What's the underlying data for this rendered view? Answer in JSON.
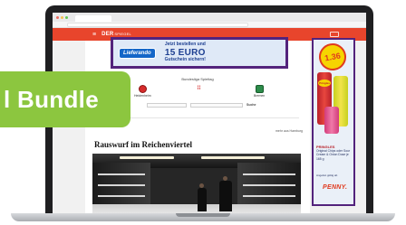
{
  "badge": {
    "label": "l Bundle"
  },
  "browser": {
    "tab_title": ""
  },
  "site": {
    "logo": "DER",
    "logo_sub": "SPIEGEL"
  },
  "ad_top": {
    "brand": "Lieferando",
    "line1": "Jetzt bestellen und",
    "amount": "15 EURO",
    "line2": "Gutschein sichern!"
  },
  "ad_side": {
    "price": "1.36",
    "product_label": "Pringles",
    "headline": "PRINGLES",
    "description": "Original Chips oder Sour Cream & Onion Dose je 165 g",
    "cta": "Angebot gültig ab",
    "brand": "PENNY."
  },
  "match": {
    "title": "Bundesliga Spieltag",
    "team_left": "Heidenheim",
    "team_mid": "",
    "team_right": "Bremen",
    "select_1": "",
    "select_2": "",
    "go": "Suche"
  },
  "section_meta": "mehr aus Hamburg",
  "article": {
    "headline": "Rauswurf im Reichenviertel"
  },
  "colors": {
    "header_red": "#e8452c",
    "ad_frame": "#53237c",
    "badge_green": "#8cc63f"
  }
}
